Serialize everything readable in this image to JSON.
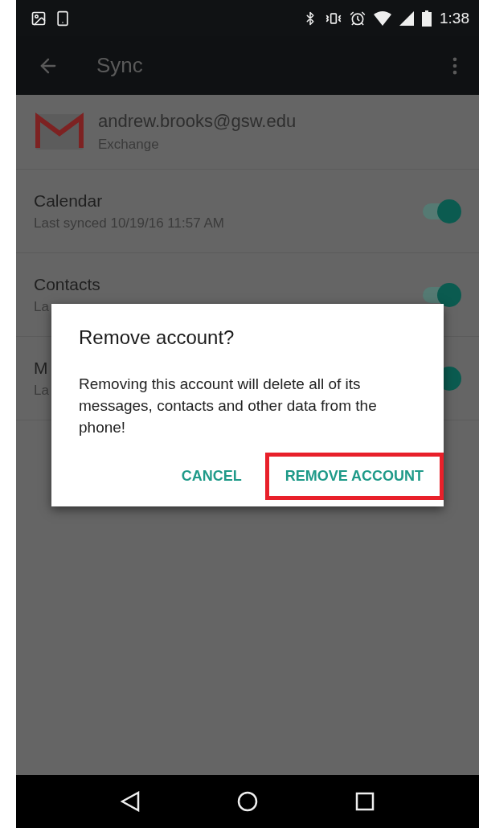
{
  "status_bar": {
    "time": "1:38"
  },
  "toolbar": {
    "title": "Sync"
  },
  "account": {
    "email": "andrew.brooks@gsw.edu",
    "type": "Exchange"
  },
  "sync_items": [
    {
      "name": "Calendar",
      "detail": "Last synced 10/19/16 11:57 AM",
      "on": true
    },
    {
      "name": "Contacts",
      "detail": "La",
      "on": true
    },
    {
      "name": "M",
      "detail": "La",
      "on": true
    }
  ],
  "dialog": {
    "title": "Remove account?",
    "message": "Removing this account will delete all of its messages, contacts and other data from the phone!",
    "buttons": [
      {
        "label": "CANCEL",
        "highlighted": false
      },
      {
        "label": "REMOVE ACCOUNT",
        "highlighted": true
      }
    ]
  }
}
